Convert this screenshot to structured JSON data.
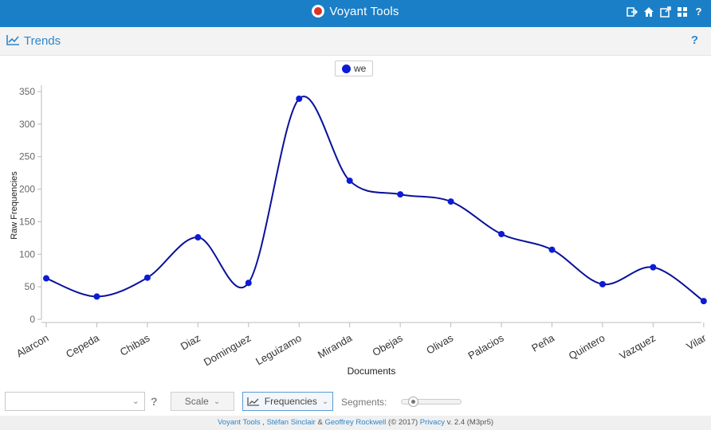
{
  "app": {
    "title": "Voyant Tools"
  },
  "topbar": {
    "icons": [
      "export-icon",
      "home-icon",
      "open-new-window-icon",
      "windows-layout-icon",
      "help-icon"
    ],
    "help_label": "?"
  },
  "panel": {
    "title": "Trends",
    "help_label": "?"
  },
  "legend": {
    "label": "we",
    "color": "#0c1bd6"
  },
  "chart_data": {
    "type": "line",
    "xlabel": "Documents",
    "ylabel": "Raw Frequencies",
    "ylim": [
      0,
      350
    ],
    "yticks": [
      0,
      50,
      100,
      150,
      200,
      250,
      300,
      350
    ],
    "categories": [
      "Alarcon",
      "Cepeda",
      "Chibas",
      "Diaz",
      "Dominguez",
      "Leguizamo",
      "Miranda",
      "Obejas",
      "Olivas",
      "Palacios",
      "Peña",
      "Quintero",
      "Vazquez",
      "Vilar"
    ],
    "series": [
      {
        "name": "we",
        "color": "#0c1bd6",
        "values": [
          63,
          35,
          64,
          126,
          56,
          339,
          213,
          192,
          181,
          131,
          107,
          54,
          80,
          28
        ]
      }
    ],
    "grid": false,
    "legend": "top-center"
  },
  "toolbar": {
    "scale_label": "Scale",
    "frequencies_label": "Frequencies",
    "segments_label": "Segments:",
    "help_label": "?",
    "search_value": ""
  },
  "footer": {
    "voyant": "Voyant Tools",
    "sep1": " , ",
    "sinclair": "Stéfan Sinclair",
    "amp": " & ",
    "rockwell": "Geoffrey Rockwell",
    "year": " (© 2017) ",
    "privacy": "Privacy",
    "version": " v. 2.4 (M3pr5)"
  }
}
